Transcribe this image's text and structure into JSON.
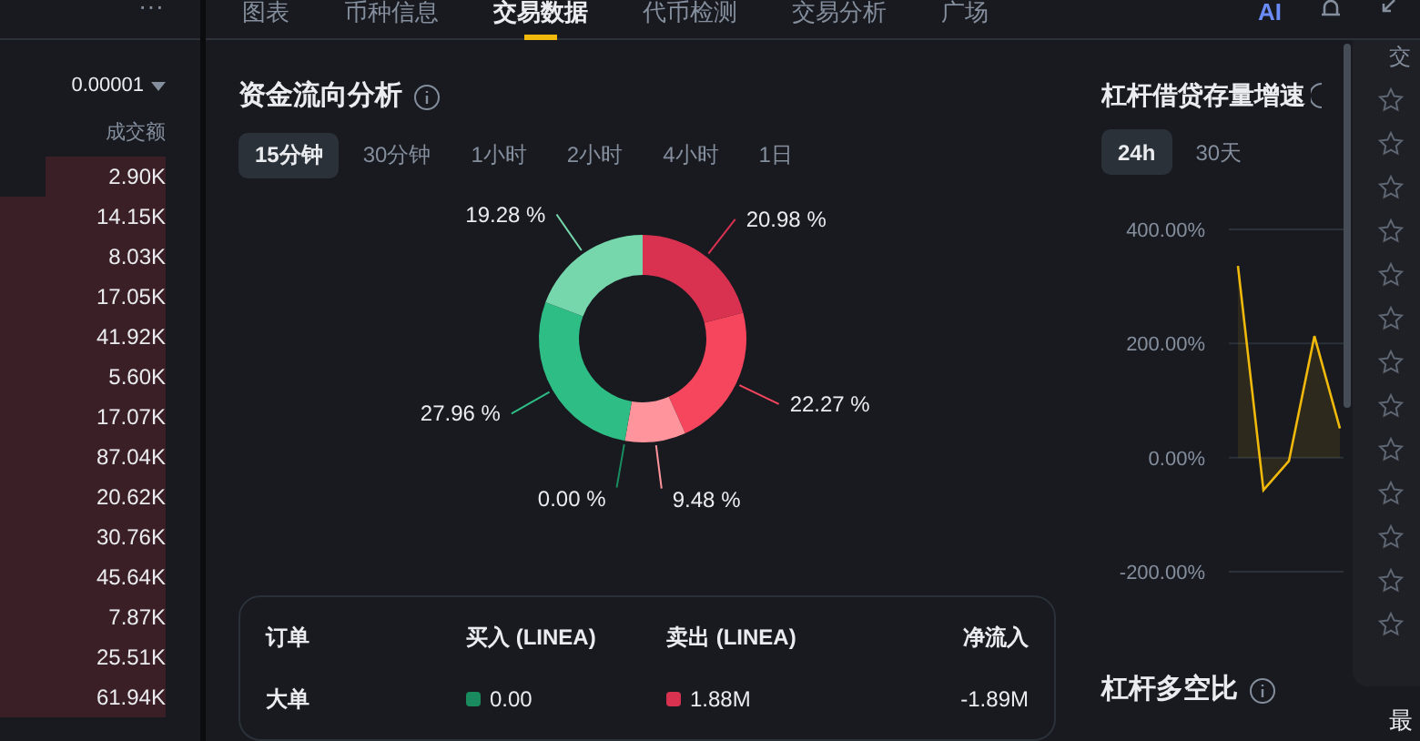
{
  "order_book": {
    "menu": "···",
    "precision": "0.00001",
    "column": "成交额",
    "rows": [
      {
        "amount": "2.90K"
      },
      {
        "amount": "14.15K"
      },
      {
        "amount": "8.03K"
      },
      {
        "amount": "17.05K"
      },
      {
        "amount": "41.92K"
      },
      {
        "amount": "5.60K"
      },
      {
        "amount": "17.07K"
      },
      {
        "amount": "87.04K"
      },
      {
        "amount": "20.62K"
      },
      {
        "amount": "30.76K"
      },
      {
        "amount": "45.64K"
      },
      {
        "amount": "7.87K"
      },
      {
        "amount": "25.51K"
      },
      {
        "amount": "61.94K"
      }
    ]
  },
  "tabs": [
    {
      "label": "图表",
      "selected": false
    },
    {
      "label": "币种信息",
      "selected": false
    },
    {
      "label": "交易数据",
      "selected": true
    },
    {
      "label": "代币检测",
      "selected": false
    },
    {
      "label": "交易分析",
      "selected": false
    },
    {
      "label": "广场",
      "selected": false
    }
  ],
  "ai_label": "AI",
  "fund_flow": {
    "title": "资金流向分析",
    "periods": [
      {
        "label": "15分钟",
        "selected": true
      },
      {
        "label": "30分钟",
        "selected": false
      },
      {
        "label": "1小时",
        "selected": false
      },
      {
        "label": "2小时",
        "selected": false
      },
      {
        "label": "4小时",
        "selected": false
      },
      {
        "label": "1日",
        "selected": false
      }
    ],
    "chart_data": {
      "type": "donut",
      "values": [
        20.98,
        22.27,
        9.48,
        0.0,
        27.96,
        19.28
      ],
      "colors": [
        "#d93251",
        "#f6465d",
        "#ff949c",
        "#1a8b5f",
        "#2ebd85",
        "#76d7ad"
      ],
      "value_labels": [
        "20.98 %",
        "22.27 %",
        "9.48 %",
        "0.00 %",
        "27.96 %",
        "19.28 %"
      ]
    },
    "table": {
      "columns": [
        "订单",
        "买入 (LINEA)",
        "卖出 (LINEA)",
        "净流入"
      ],
      "rows": [
        {
          "order": "大单",
          "buy": "0.00",
          "sell": "1.88M",
          "net": "-1.89M"
        }
      ]
    }
  },
  "margin_growth": {
    "title": "杠杆借贷存量增速",
    "periods": [
      {
        "label": "24h",
        "selected": true
      },
      {
        "label": "30天",
        "selected": false
      }
    ],
    "chart_data": {
      "type": "area",
      "series": [
        {
          "color": "#f0b90b",
          "values": [
            336,
            -57,
            -6,
            213,
            51
          ]
        }
      ],
      "ylim": [
        -200,
        400
      ],
      "yticks": [
        {
          "value": 400,
          "label": "400.00%"
        },
        {
          "value": 200,
          "label": "200.00%"
        },
        {
          "value": 0,
          "label": "0.00%"
        },
        {
          "value": -200,
          "label": "-200.00%"
        }
      ]
    }
  },
  "long_short_title": "杠杆多空比",
  "side_list": {
    "header": "交",
    "footer": "最"
  }
}
